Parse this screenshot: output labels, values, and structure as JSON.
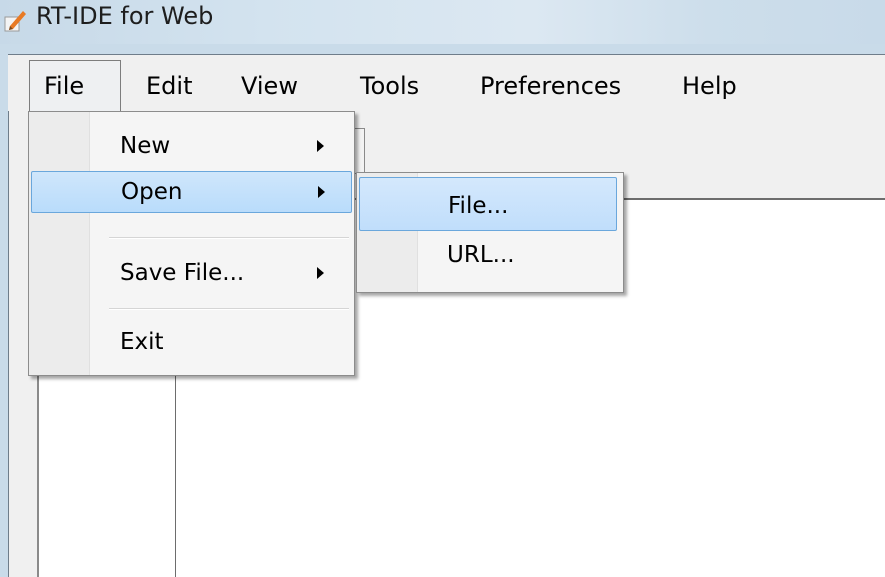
{
  "window": {
    "title": "RT-IDE for Web",
    "icon": "pencil-notepad-icon"
  },
  "menubar": {
    "items": [
      {
        "label": "File",
        "open": true
      },
      {
        "label": "Edit"
      },
      {
        "label": "View"
      },
      {
        "label": "Tools"
      },
      {
        "label": "Preferences"
      },
      {
        "label": "Help"
      }
    ]
  },
  "file_menu": {
    "items": [
      {
        "label": "New",
        "submenu": true
      },
      {
        "label": "Open",
        "submenu": true,
        "highlighted": true
      },
      {
        "label": "Save File...",
        "submenu": true
      },
      {
        "label": "Exit"
      }
    ]
  },
  "open_submenu": {
    "items": [
      {
        "label": "File...",
        "highlighted": true
      },
      {
        "label": "URL..."
      }
    ]
  },
  "colors": {
    "highlight_fill": "#c5e1fb",
    "highlight_border": "#6aa7dc",
    "menu_bg": "#f0f0f0"
  }
}
